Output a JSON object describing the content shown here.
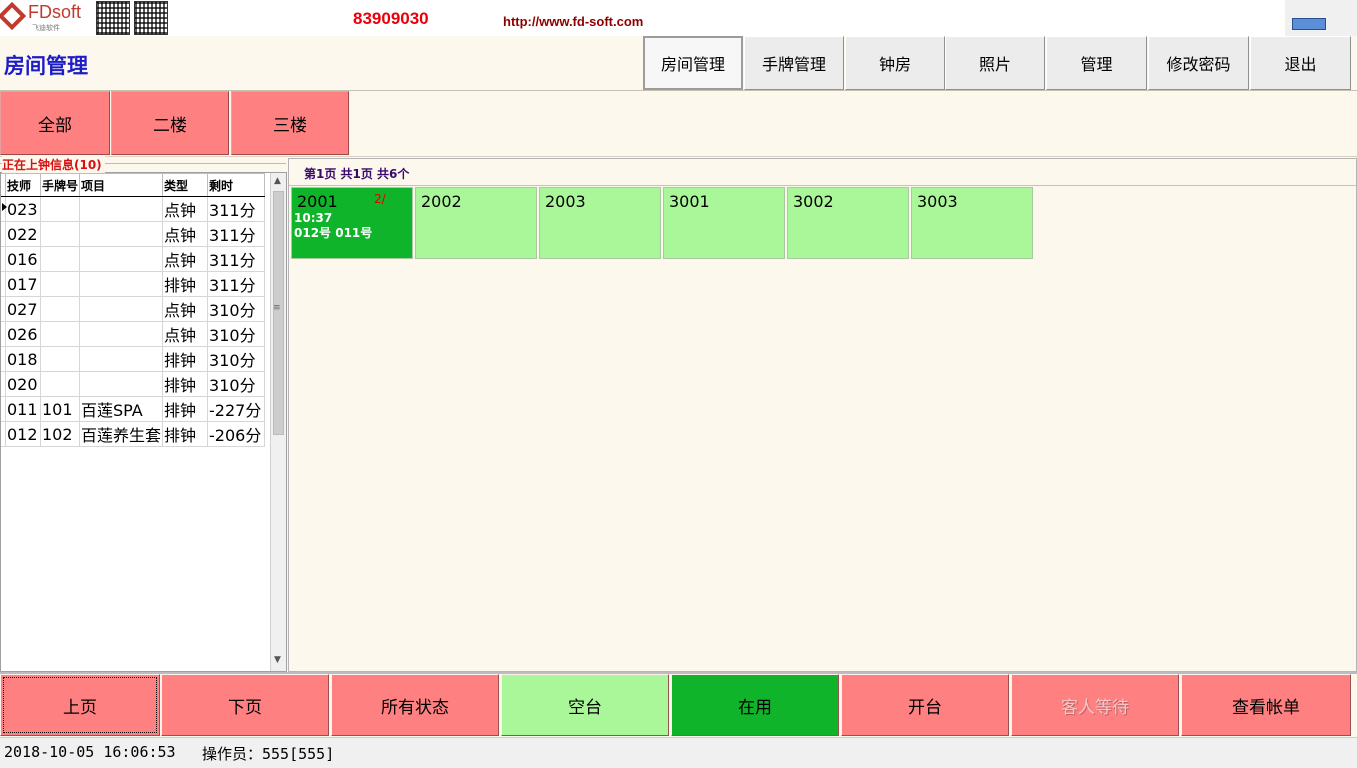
{
  "header": {
    "logo_text": "FDsoft",
    "logo_sub": "飞迪软件",
    "phone": "83909030",
    "url": "http://www.fd-soft.com"
  },
  "title": "房间管理",
  "nav": [
    {
      "label": "房间管理",
      "active": true
    },
    {
      "label": "手牌管理"
    },
    {
      "label": "钟房"
    },
    {
      "label": "照片"
    },
    {
      "label": "管理"
    },
    {
      "label": "修改密码"
    },
    {
      "label": "退出"
    }
  ],
  "floors": [
    "全部",
    "二楼",
    "三楼"
  ],
  "left_panel": {
    "title": "正在上钟信息(10)",
    "columns": [
      "技师",
      "手牌号",
      "项目",
      "类型",
      "剩时"
    ],
    "rows": [
      [
        "023",
        "",
        "",
        "点钟",
        "311分"
      ],
      [
        "022",
        "",
        "",
        "点钟",
        "311分"
      ],
      [
        "016",
        "",
        "",
        "点钟",
        "311分"
      ],
      [
        "017",
        "",
        "",
        "排钟",
        "311分"
      ],
      [
        "027",
        "",
        "",
        "点钟",
        "310分"
      ],
      [
        "026",
        "",
        "",
        "点钟",
        "310分"
      ],
      [
        "018",
        "",
        "",
        "排钟",
        "310分"
      ],
      [
        "020",
        "",
        "",
        "排钟",
        "310分"
      ],
      [
        "011",
        "101",
        "百莲SPA",
        "排钟",
        "-227分"
      ],
      [
        "012",
        "102",
        "百莲养生套",
        "排钟",
        "-206分"
      ]
    ]
  },
  "rooms_panel": {
    "page_info": "第1页  共1页  共6个",
    "rooms": [
      {
        "name": "2001",
        "status": "used",
        "count": "2/",
        "time": "10:37",
        "techs": "012号  011号"
      },
      {
        "name": "2002",
        "status": "free"
      },
      {
        "name": "2003",
        "status": "free"
      },
      {
        "name": "3001",
        "status": "free"
      },
      {
        "name": "3002",
        "status": "free"
      },
      {
        "name": "3003",
        "status": "free"
      }
    ]
  },
  "actions": [
    "上页",
    "下页",
    "所有状态",
    "空台",
    "在用",
    "开台",
    "客人等待",
    "查看帐单"
  ],
  "status_bar": {
    "datetime": "2018-10-05 16:06:53",
    "operator": "操作员：555[555]"
  },
  "colors": {
    "room_free": "#aaf79a",
    "room_used": "#10b42a",
    "button_red": "#ff8080",
    "title_blue": "#1c1cc8",
    "phone_red": "#e8000b"
  }
}
